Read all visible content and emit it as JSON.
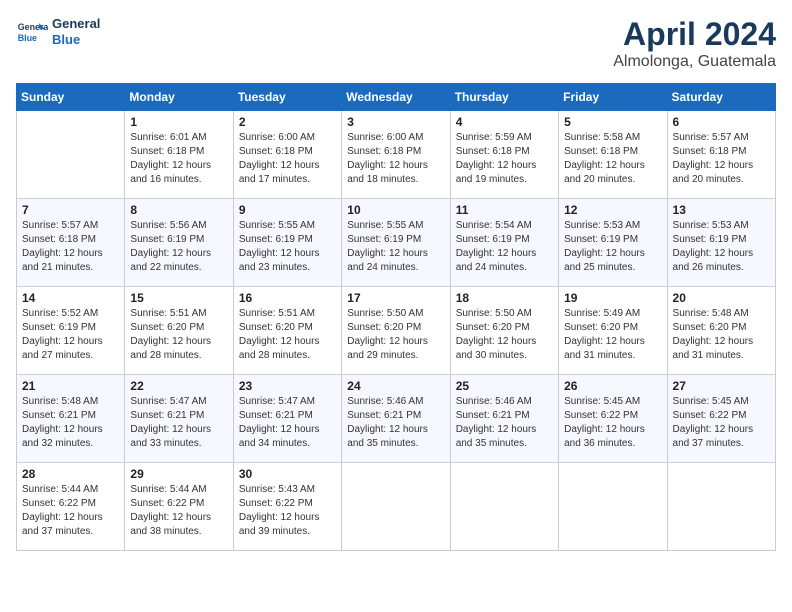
{
  "header": {
    "logo_line1": "General",
    "logo_line2": "Blue",
    "month": "April 2024",
    "location": "Almolonga, Guatemala"
  },
  "columns": [
    "Sunday",
    "Monday",
    "Tuesday",
    "Wednesday",
    "Thursday",
    "Friday",
    "Saturday"
  ],
  "weeks": [
    [
      {
        "day": "",
        "info": ""
      },
      {
        "day": "1",
        "info": "Sunrise: 6:01 AM\nSunset: 6:18 PM\nDaylight: 12 hours\nand 16 minutes."
      },
      {
        "day": "2",
        "info": "Sunrise: 6:00 AM\nSunset: 6:18 PM\nDaylight: 12 hours\nand 17 minutes."
      },
      {
        "day": "3",
        "info": "Sunrise: 6:00 AM\nSunset: 6:18 PM\nDaylight: 12 hours\nand 18 minutes."
      },
      {
        "day": "4",
        "info": "Sunrise: 5:59 AM\nSunset: 6:18 PM\nDaylight: 12 hours\nand 19 minutes."
      },
      {
        "day": "5",
        "info": "Sunrise: 5:58 AM\nSunset: 6:18 PM\nDaylight: 12 hours\nand 20 minutes."
      },
      {
        "day": "6",
        "info": "Sunrise: 5:57 AM\nSunset: 6:18 PM\nDaylight: 12 hours\nand 20 minutes."
      }
    ],
    [
      {
        "day": "7",
        "info": "Sunrise: 5:57 AM\nSunset: 6:18 PM\nDaylight: 12 hours\nand 21 minutes."
      },
      {
        "day": "8",
        "info": "Sunrise: 5:56 AM\nSunset: 6:19 PM\nDaylight: 12 hours\nand 22 minutes."
      },
      {
        "day": "9",
        "info": "Sunrise: 5:55 AM\nSunset: 6:19 PM\nDaylight: 12 hours\nand 23 minutes."
      },
      {
        "day": "10",
        "info": "Sunrise: 5:55 AM\nSunset: 6:19 PM\nDaylight: 12 hours\nand 24 minutes."
      },
      {
        "day": "11",
        "info": "Sunrise: 5:54 AM\nSunset: 6:19 PM\nDaylight: 12 hours\nand 24 minutes."
      },
      {
        "day": "12",
        "info": "Sunrise: 5:53 AM\nSunset: 6:19 PM\nDaylight: 12 hours\nand 25 minutes."
      },
      {
        "day": "13",
        "info": "Sunrise: 5:53 AM\nSunset: 6:19 PM\nDaylight: 12 hours\nand 26 minutes."
      }
    ],
    [
      {
        "day": "14",
        "info": "Sunrise: 5:52 AM\nSunset: 6:19 PM\nDaylight: 12 hours\nand 27 minutes."
      },
      {
        "day": "15",
        "info": "Sunrise: 5:51 AM\nSunset: 6:20 PM\nDaylight: 12 hours\nand 28 minutes."
      },
      {
        "day": "16",
        "info": "Sunrise: 5:51 AM\nSunset: 6:20 PM\nDaylight: 12 hours\nand 28 minutes."
      },
      {
        "day": "17",
        "info": "Sunrise: 5:50 AM\nSunset: 6:20 PM\nDaylight: 12 hours\nand 29 minutes."
      },
      {
        "day": "18",
        "info": "Sunrise: 5:50 AM\nSunset: 6:20 PM\nDaylight: 12 hours\nand 30 minutes."
      },
      {
        "day": "19",
        "info": "Sunrise: 5:49 AM\nSunset: 6:20 PM\nDaylight: 12 hours\nand 31 minutes."
      },
      {
        "day": "20",
        "info": "Sunrise: 5:48 AM\nSunset: 6:20 PM\nDaylight: 12 hours\nand 31 minutes."
      }
    ],
    [
      {
        "day": "21",
        "info": "Sunrise: 5:48 AM\nSunset: 6:21 PM\nDaylight: 12 hours\nand 32 minutes."
      },
      {
        "day": "22",
        "info": "Sunrise: 5:47 AM\nSunset: 6:21 PM\nDaylight: 12 hours\nand 33 minutes."
      },
      {
        "day": "23",
        "info": "Sunrise: 5:47 AM\nSunset: 6:21 PM\nDaylight: 12 hours\nand 34 minutes."
      },
      {
        "day": "24",
        "info": "Sunrise: 5:46 AM\nSunset: 6:21 PM\nDaylight: 12 hours\nand 35 minutes."
      },
      {
        "day": "25",
        "info": "Sunrise: 5:46 AM\nSunset: 6:21 PM\nDaylight: 12 hours\nand 35 minutes."
      },
      {
        "day": "26",
        "info": "Sunrise: 5:45 AM\nSunset: 6:22 PM\nDaylight: 12 hours\nand 36 minutes."
      },
      {
        "day": "27",
        "info": "Sunrise: 5:45 AM\nSunset: 6:22 PM\nDaylight: 12 hours\nand 37 minutes."
      }
    ],
    [
      {
        "day": "28",
        "info": "Sunrise: 5:44 AM\nSunset: 6:22 PM\nDaylight: 12 hours\nand 37 minutes."
      },
      {
        "day": "29",
        "info": "Sunrise: 5:44 AM\nSunset: 6:22 PM\nDaylight: 12 hours\nand 38 minutes."
      },
      {
        "day": "30",
        "info": "Sunrise: 5:43 AM\nSunset: 6:22 PM\nDaylight: 12 hours\nand 39 minutes."
      },
      {
        "day": "",
        "info": ""
      },
      {
        "day": "",
        "info": ""
      },
      {
        "day": "",
        "info": ""
      },
      {
        "day": "",
        "info": ""
      }
    ]
  ]
}
